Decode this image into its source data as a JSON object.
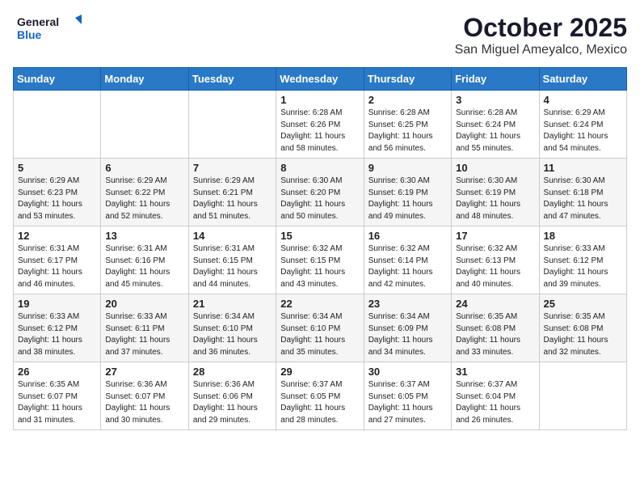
{
  "header": {
    "logo_line1": "General",
    "logo_line2": "Blue",
    "month_title": "October 2025",
    "location": "San Miguel Ameyalco, Mexico"
  },
  "weekdays": [
    "Sunday",
    "Monday",
    "Tuesday",
    "Wednesday",
    "Thursday",
    "Friday",
    "Saturday"
  ],
  "weeks": [
    [
      {
        "day": "",
        "sunrise": "",
        "sunset": "",
        "daylight": ""
      },
      {
        "day": "",
        "sunrise": "",
        "sunset": "",
        "daylight": ""
      },
      {
        "day": "",
        "sunrise": "",
        "sunset": "",
        "daylight": ""
      },
      {
        "day": "1",
        "sunrise": "Sunrise: 6:28 AM",
        "sunset": "Sunset: 6:26 PM",
        "daylight": "Daylight: 11 hours and 58 minutes."
      },
      {
        "day": "2",
        "sunrise": "Sunrise: 6:28 AM",
        "sunset": "Sunset: 6:25 PM",
        "daylight": "Daylight: 11 hours and 56 minutes."
      },
      {
        "day": "3",
        "sunrise": "Sunrise: 6:28 AM",
        "sunset": "Sunset: 6:24 PM",
        "daylight": "Daylight: 11 hours and 55 minutes."
      },
      {
        "day": "4",
        "sunrise": "Sunrise: 6:29 AM",
        "sunset": "Sunset: 6:24 PM",
        "daylight": "Daylight: 11 hours and 54 minutes."
      }
    ],
    [
      {
        "day": "5",
        "sunrise": "Sunrise: 6:29 AM",
        "sunset": "Sunset: 6:23 PM",
        "daylight": "Daylight: 11 hours and 53 minutes."
      },
      {
        "day": "6",
        "sunrise": "Sunrise: 6:29 AM",
        "sunset": "Sunset: 6:22 PM",
        "daylight": "Daylight: 11 hours and 52 minutes."
      },
      {
        "day": "7",
        "sunrise": "Sunrise: 6:29 AM",
        "sunset": "Sunset: 6:21 PM",
        "daylight": "Daylight: 11 hours and 51 minutes."
      },
      {
        "day": "8",
        "sunrise": "Sunrise: 6:30 AM",
        "sunset": "Sunset: 6:20 PM",
        "daylight": "Daylight: 11 hours and 50 minutes."
      },
      {
        "day": "9",
        "sunrise": "Sunrise: 6:30 AM",
        "sunset": "Sunset: 6:19 PM",
        "daylight": "Daylight: 11 hours and 49 minutes."
      },
      {
        "day": "10",
        "sunrise": "Sunrise: 6:30 AM",
        "sunset": "Sunset: 6:19 PM",
        "daylight": "Daylight: 11 hours and 48 minutes."
      },
      {
        "day": "11",
        "sunrise": "Sunrise: 6:30 AM",
        "sunset": "Sunset: 6:18 PM",
        "daylight": "Daylight: 11 hours and 47 minutes."
      }
    ],
    [
      {
        "day": "12",
        "sunrise": "Sunrise: 6:31 AM",
        "sunset": "Sunset: 6:17 PM",
        "daylight": "Daylight: 11 hours and 46 minutes."
      },
      {
        "day": "13",
        "sunrise": "Sunrise: 6:31 AM",
        "sunset": "Sunset: 6:16 PM",
        "daylight": "Daylight: 11 hours and 45 minutes."
      },
      {
        "day": "14",
        "sunrise": "Sunrise: 6:31 AM",
        "sunset": "Sunset: 6:15 PM",
        "daylight": "Daylight: 11 hours and 44 minutes."
      },
      {
        "day": "15",
        "sunrise": "Sunrise: 6:32 AM",
        "sunset": "Sunset: 6:15 PM",
        "daylight": "Daylight: 11 hours and 43 minutes."
      },
      {
        "day": "16",
        "sunrise": "Sunrise: 6:32 AM",
        "sunset": "Sunset: 6:14 PM",
        "daylight": "Daylight: 11 hours and 42 minutes."
      },
      {
        "day": "17",
        "sunrise": "Sunrise: 6:32 AM",
        "sunset": "Sunset: 6:13 PM",
        "daylight": "Daylight: 11 hours and 40 minutes."
      },
      {
        "day": "18",
        "sunrise": "Sunrise: 6:33 AM",
        "sunset": "Sunset: 6:12 PM",
        "daylight": "Daylight: 11 hours and 39 minutes."
      }
    ],
    [
      {
        "day": "19",
        "sunrise": "Sunrise: 6:33 AM",
        "sunset": "Sunset: 6:12 PM",
        "daylight": "Daylight: 11 hours and 38 minutes."
      },
      {
        "day": "20",
        "sunrise": "Sunrise: 6:33 AM",
        "sunset": "Sunset: 6:11 PM",
        "daylight": "Daylight: 11 hours and 37 minutes."
      },
      {
        "day": "21",
        "sunrise": "Sunrise: 6:34 AM",
        "sunset": "Sunset: 6:10 PM",
        "daylight": "Daylight: 11 hours and 36 minutes."
      },
      {
        "day": "22",
        "sunrise": "Sunrise: 6:34 AM",
        "sunset": "Sunset: 6:10 PM",
        "daylight": "Daylight: 11 hours and 35 minutes."
      },
      {
        "day": "23",
        "sunrise": "Sunrise: 6:34 AM",
        "sunset": "Sunset: 6:09 PM",
        "daylight": "Daylight: 11 hours and 34 minutes."
      },
      {
        "day": "24",
        "sunrise": "Sunrise: 6:35 AM",
        "sunset": "Sunset: 6:08 PM",
        "daylight": "Daylight: 11 hours and 33 minutes."
      },
      {
        "day": "25",
        "sunrise": "Sunrise: 6:35 AM",
        "sunset": "Sunset: 6:08 PM",
        "daylight": "Daylight: 11 hours and 32 minutes."
      }
    ],
    [
      {
        "day": "26",
        "sunrise": "Sunrise: 6:35 AM",
        "sunset": "Sunset: 6:07 PM",
        "daylight": "Daylight: 11 hours and 31 minutes."
      },
      {
        "day": "27",
        "sunrise": "Sunrise: 6:36 AM",
        "sunset": "Sunset: 6:07 PM",
        "daylight": "Daylight: 11 hours and 30 minutes."
      },
      {
        "day": "28",
        "sunrise": "Sunrise: 6:36 AM",
        "sunset": "Sunset: 6:06 PM",
        "daylight": "Daylight: 11 hours and 29 minutes."
      },
      {
        "day": "29",
        "sunrise": "Sunrise: 6:37 AM",
        "sunset": "Sunset: 6:05 PM",
        "daylight": "Daylight: 11 hours and 28 minutes."
      },
      {
        "day": "30",
        "sunrise": "Sunrise: 6:37 AM",
        "sunset": "Sunset: 6:05 PM",
        "daylight": "Daylight: 11 hours and 27 minutes."
      },
      {
        "day": "31",
        "sunrise": "Sunrise: 6:37 AM",
        "sunset": "Sunset: 6:04 PM",
        "daylight": "Daylight: 11 hours and 26 minutes."
      },
      {
        "day": "",
        "sunrise": "",
        "sunset": "",
        "daylight": ""
      }
    ]
  ]
}
